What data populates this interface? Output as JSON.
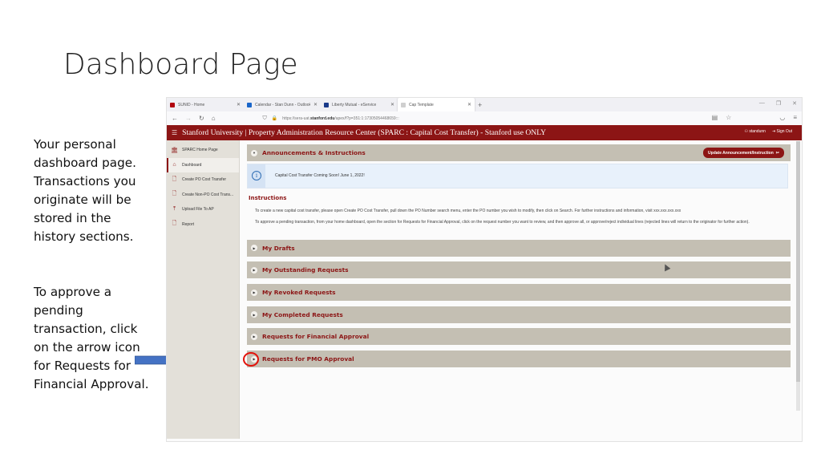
{
  "slide": {
    "title": "Dashboard Page",
    "note_1": "Your personal dashboard page. Transactions you originate will be stored in the history sections.",
    "note_2": "To approve a pending transaction, click on the arrow icon for Requests for Financial Approval.",
    "arrow_color": "#4472c4",
    "highlight_color": "#e3120b"
  },
  "browser": {
    "tabs": [
      {
        "label": "SUNID - Home",
        "icon": "stanford-favicon",
        "color": "#b1040e"
      },
      {
        "label": "Calendar - Stan Dunn - Outlook",
        "icon": "outlook-favicon",
        "color": "#1a66c9"
      },
      {
        "label": "Liberty Mutual - eService",
        "icon": "liberty-favicon",
        "color": "#1a3a8a"
      },
      {
        "label": "Cap Template",
        "icon": "page-favicon",
        "color": "#bbbbbb",
        "active": true
      }
    ],
    "url_prefix": "https://sera-uat.",
    "url_domain": "stanford.edu",
    "url_suffix": "/apex/f?p=351:1:17305054468659:::",
    "icons": [
      "back-icon",
      "forward-icon",
      "reload-icon",
      "home-icon",
      "shield-icon",
      "lock-icon",
      "reader-icon",
      "star-icon",
      "pocket-icon",
      "menu-icon"
    ]
  },
  "app": {
    "header_title": "Stanford University | Property Administration Resource Center (SPARC : Capital Cost Transfer) - Stanford use ONLY",
    "username": "standunn",
    "sign_out": "Sign Out",
    "brand_color": "#8c1515",
    "nav": [
      {
        "label": "SPARC Home Page",
        "icon": "bank-icon",
        "glyph": "🏛"
      },
      {
        "label": "Dashboard",
        "icon": "home-icon",
        "glyph": "⌂",
        "active": true
      },
      {
        "label": "Create PO Cost Transfer",
        "icon": "file-plus-icon",
        "glyph": "🗋"
      },
      {
        "label": "Create Non-PO Cost Trans...",
        "icon": "file-plus-icon",
        "glyph": "🗋"
      },
      {
        "label": "Upload File To AP",
        "icon": "upload-icon",
        "glyph": "⤒"
      },
      {
        "label": "Report",
        "icon": "document-icon",
        "glyph": "🗋"
      }
    ],
    "announcements": {
      "title": "Announcements & Instructions",
      "update_button": "Update Announcement/Instruction",
      "message": "Capital Cost Transfer Coming Soon!  June 1, 2022!",
      "instructions_title": "Instructions",
      "paragraph_1": "To create a new capital cost transfer, please open Create PO Cost Transfer, pull down the PO Number search menu, enter the PO number you wish to modify, then click on Search.  For further instructions and information, visit xxx.xxx.xxx.xxx",
      "paragraph_2": "To approve a pending transaction, from your home dashboard, open the section for Requests for Financial Approval, click on the request number you want to review, and then approve all, or approve/reject individual lines (rejected lines will return to the originator for further action)."
    },
    "sections": [
      {
        "label": "My Drafts"
      },
      {
        "label": "My Outstanding Requests"
      },
      {
        "label": "My Revoked Requests"
      },
      {
        "label": "My Completed Requests"
      },
      {
        "label": "Requests for Financial Approval",
        "highlighted": true
      },
      {
        "label": "Requests for PMO Approval"
      }
    ]
  }
}
